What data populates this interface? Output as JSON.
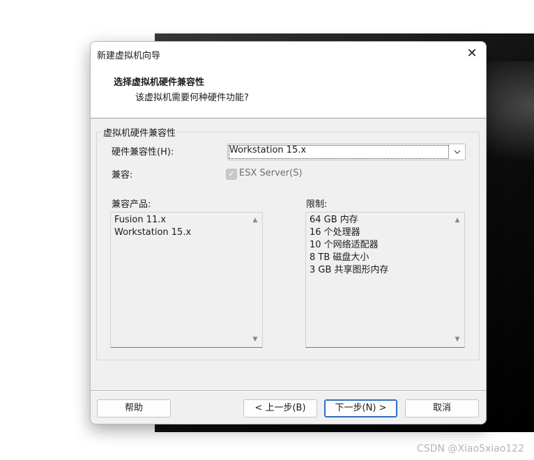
{
  "dialog": {
    "title": "新建虚拟机向导",
    "header_title": "选择虚拟机硬件兼容性",
    "header_subtitle": "该虚拟机需要何种硬件功能?"
  },
  "group": {
    "label": "虚拟机硬件兼容性",
    "hardware_label": "硬件兼容性(H):",
    "hardware_value": "Workstation 15.x",
    "compat_label": "兼容:",
    "esx_label": "ESX Server(S)",
    "esx_checked": true,
    "products_label": "兼容产品:",
    "products": [
      "Fusion 11.x",
      "Workstation 15.x"
    ],
    "limits_label": "限制:",
    "limits": [
      "64 GB 内存",
      "16 个处理器",
      "10 个网络适配器",
      "8 TB 磁盘大小",
      "3 GB 共享图形内存"
    ]
  },
  "buttons": {
    "help": "帮助",
    "back": "< 上一步(B)",
    "next": "下一步(N) >",
    "cancel": "取消"
  },
  "watermark": "CSDN @Xiao5xiao122",
  "icons": {
    "close": "close-icon",
    "dropdown": "chevron-down-icon",
    "check": "checkmark-icon",
    "scroll_up": "scroll-up-arrow-icon",
    "scroll_down": "scroll-down-arrow-icon"
  }
}
